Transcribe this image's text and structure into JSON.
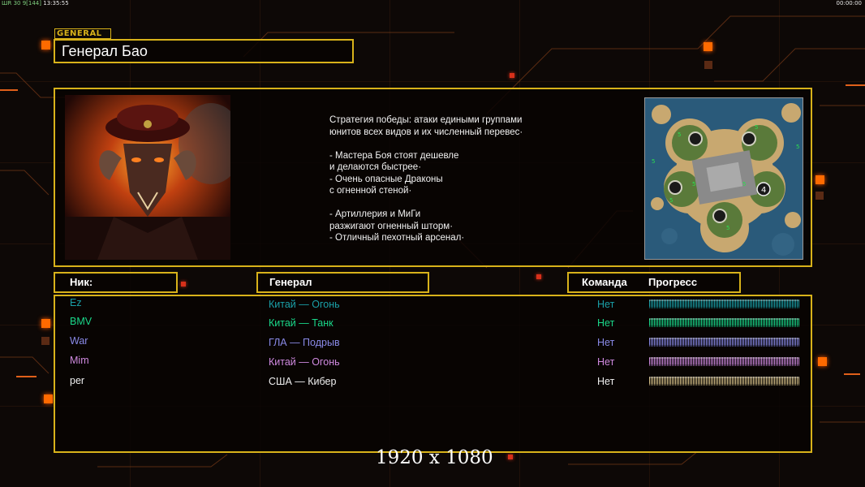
{
  "status_bar": {
    "left_prefix": "ШR 30 9",
    "left_bracket": "[144]",
    "left_time": "13:35:55",
    "right_time": "00:00:00"
  },
  "general_tag": "GENERAL",
  "general_name": "Генерал Бао",
  "description": {
    "lines_a": [
      "Стратегия победы: атаки едиными группами",
      "юнитов всех видов и их численный перевес·"
    ],
    "lines_b": [
      "- Мастера Боя стоят дешевле",
      "и делаются быстрее·",
      "- Очень опасные Драконы",
      "с огненной стеной·"
    ],
    "lines_c": [
      "- Артиллерия и МиГи",
      "разжигают огненный шторм·",
      "- Отличный пехотный арсенал·"
    ]
  },
  "map": {
    "marker_label": "4"
  },
  "headers": {
    "nick": "Ник:",
    "general": "Генерал",
    "team": "Команда",
    "progress": "Прогресс"
  },
  "players": [
    {
      "nick": "Ez",
      "general": "Китай — Огонь",
      "team": "Нет",
      "color": "#1aa0a8",
      "progress": 1.0
    },
    {
      "nick": "BMV",
      "general": "Китай — Танк",
      "team": "Нет",
      "color": "#1ad88a",
      "progress": 1.0
    },
    {
      "nick": "War",
      "general": "ГЛА — Подрыв",
      "team": "Нет",
      "color": "#8a8ae8",
      "progress": 1.0
    },
    {
      "nick": "Mim",
      "general": "Китай — Огонь",
      "team": "Нет",
      "color": "#d08ae0",
      "progress": 1.0
    },
    {
      "nick": "per",
      "general": "США — Кибер",
      "team": "Нет",
      "color": "#f0f0f0",
      "progress": 1.0
    }
  ],
  "colors": {
    "frame": "#d8b21a",
    "accent": "#ff6a00",
    "player5_bar": "#d8c28a"
  },
  "resolution_note": "1920 x 1080"
}
